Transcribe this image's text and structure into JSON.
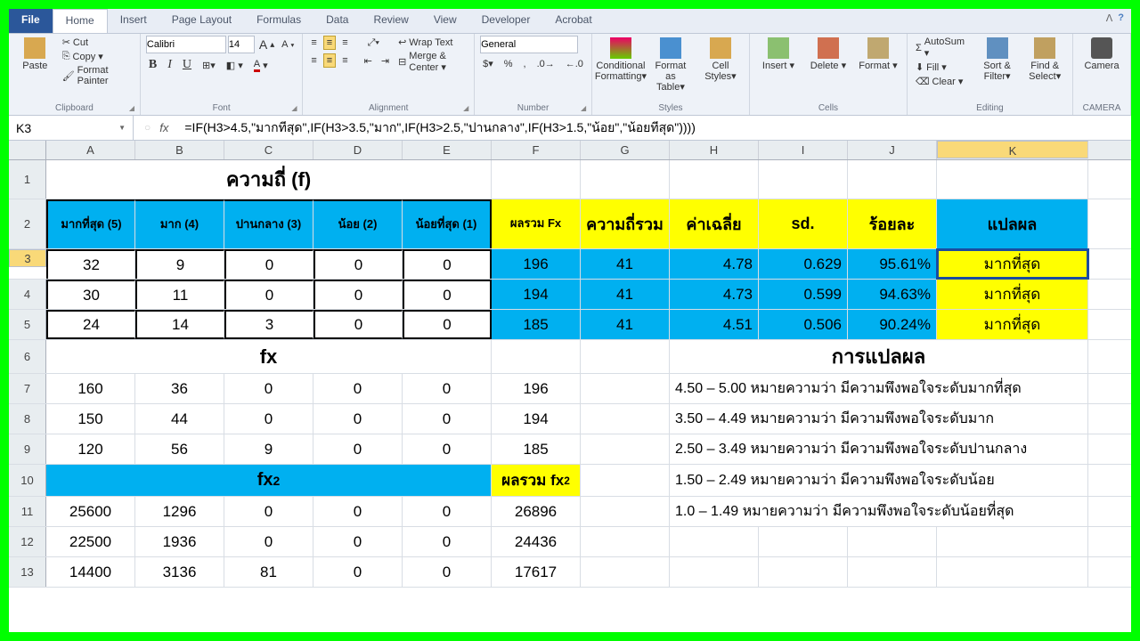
{
  "tabs": {
    "file": "File",
    "home": "Home",
    "insert": "Insert",
    "page_layout": "Page Layout",
    "formulas": "Formulas",
    "data": "Data",
    "review": "Review",
    "view": "View",
    "developer": "Developer",
    "acrobat": "Acrobat"
  },
  "ribbon": {
    "clipboard": {
      "title": "Clipboard",
      "paste": "Paste",
      "cut": "Cut",
      "copy": "Copy ▾",
      "format_painter": "Format Painter"
    },
    "font": {
      "title": "Font",
      "name": "Calibri",
      "size": "14"
    },
    "alignment": {
      "title": "Alignment",
      "wrap": "Wrap Text",
      "merge": "Merge & Center ▾"
    },
    "number": {
      "title": "Number",
      "format": "General"
    },
    "styles": {
      "title": "Styles",
      "cond": "Conditional Formatting▾",
      "table": "Format as Table▾",
      "cell": "Cell Styles▾"
    },
    "cells": {
      "title": "Cells",
      "insert": "Insert ▾",
      "delete": "Delete ▾",
      "format": "Format ▾"
    },
    "editing": {
      "title": "Editing",
      "autosum": "AutoSum ▾",
      "fill": "Fill ▾",
      "clear": "Clear ▾",
      "sort": "Sort & Filter▾",
      "find": "Find & Select▾"
    },
    "camera": {
      "title": "CAMERA",
      "label": "Camera"
    }
  },
  "fx": {
    "cell_ref": "K3",
    "formula": "=IF(H3>4.5,\"มากที่สุด\",IF(H3>3.5,\"มาก\",IF(H3>2.5,\"ปานกลาง\",IF(H3>1.5,\"น้อย\",\"น้อยที่สุด\"))))"
  },
  "cols": [
    "A",
    "B",
    "C",
    "D",
    "E",
    "F",
    "G",
    "H",
    "I",
    "J",
    "K"
  ],
  "r1": {
    "title": "ความถี่ (f)"
  },
  "r2": {
    "a": "มากที่สุด (5)",
    "b": "มาก (4)",
    "c": "ปานกลาง (3)",
    "d": "น้อย (2)",
    "e": "น้อยที่สุด (1)",
    "f": "ผลรวม Fx",
    "g": "ความถี่รวม",
    "h": "ค่าเฉลี่ย",
    "i": "sd.",
    "j": "ร้อยละ",
    "k": "แปลผล"
  },
  "r3": {
    "a": "32",
    "b": "9",
    "c": "0",
    "d": "0",
    "e": "0",
    "f": "196",
    "g": "41",
    "h": "4.78",
    "i": "0.629",
    "j": "95.61%",
    "k": "มากที่สุด"
  },
  "r4": {
    "a": "30",
    "b": "11",
    "c": "0",
    "d": "0",
    "e": "0",
    "f": "194",
    "g": "41",
    "h": "4.73",
    "i": "0.599",
    "j": "94.63%",
    "k": "มากที่สุด"
  },
  "r5": {
    "a": "24",
    "b": "14",
    "c": "3",
    "d": "0",
    "e": "0",
    "f": "185",
    "g": "41",
    "h": "4.51",
    "i": "0.506",
    "j": "90.24%",
    "k": "มากที่สุด"
  },
  "r6": {
    "c": "fx",
    "hk": "การแปลผล"
  },
  "r7": {
    "a": "160",
    "b": "36",
    "c": "0",
    "d": "0",
    "e": "0",
    "f": "196",
    "h": "4.50 – 5.00  หมายความว่า  มีความพึงพอใจระดับมากที่สุด"
  },
  "r8": {
    "a": "150",
    "b": "44",
    "c": "0",
    "d": "0",
    "e": "0",
    "f": "194",
    "h": "3.50 – 4.49  หมายความว่า  มีความพึงพอใจระดับมาก"
  },
  "r9": {
    "a": "120",
    "b": "56",
    "c": "9",
    "d": "0",
    "e": "0",
    "f": "185",
    "h": "2.50 – 3.49  หมายความว่า  มีความพึงพอใจระดับปานกลาง"
  },
  "r10": {
    "c": "fx²",
    "f": "ผลรวม fx²",
    "h": "1.50 – 2.49  หมายความว่า  มีความพึงพอใจระดับน้อย"
  },
  "r11": {
    "a": "25600",
    "b": "1296",
    "c": "0",
    "d": "0",
    "e": "0",
    "f": "26896",
    "h": "1.0 – 1.49  หมายความว่า  มีความพึงพอใจระดับน้อยที่สุด"
  },
  "r12": {
    "a": "22500",
    "b": "1936",
    "c": "0",
    "d": "0",
    "e": "0",
    "f": "24436"
  },
  "r13": {
    "a": "14400",
    "b": "3136",
    "c": "81",
    "d": "0",
    "e": "0",
    "f": "17617"
  }
}
